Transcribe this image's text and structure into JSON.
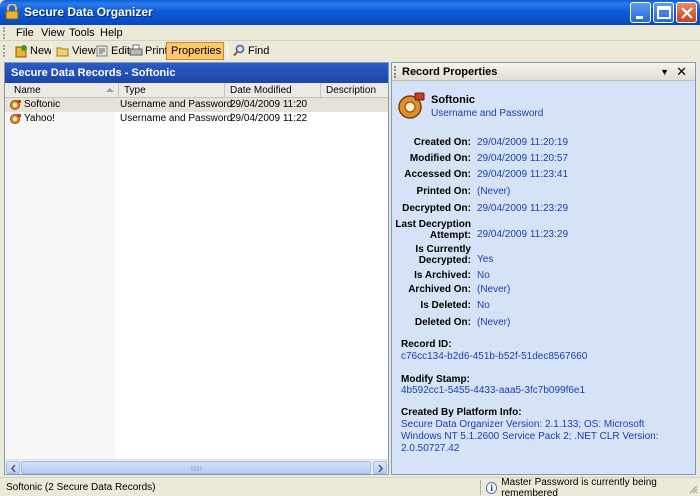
{
  "window": {
    "title": "Secure Data Organizer",
    "icon": "padlock-icon"
  },
  "menu": [
    "File",
    "View",
    "Tools",
    "Help"
  ],
  "toolbar": {
    "buttons": [
      {
        "label": "New",
        "icon": "new-record-icon"
      },
      {
        "label": "View",
        "icon": "folder-open-icon"
      },
      {
        "label": "Edit",
        "icon": "edit-icon"
      },
      {
        "label": "Print",
        "icon": "printer-icon"
      },
      {
        "label": "Properties",
        "icon": "properties-icon",
        "active": true
      },
      {
        "label": "Find",
        "icon": "search-icon"
      }
    ]
  },
  "records": {
    "header": "Secure Data Records - Softonic",
    "columns": [
      "Name",
      "Type",
      "Date Modified",
      "Description"
    ],
    "rows": [
      {
        "name": "Softonic",
        "type": "Username and Password",
        "date": "29/04/2009 11:20",
        "description": "",
        "selected": true
      },
      {
        "name": "Yahoo!",
        "type": "Username and Password",
        "date": "29/04/2009 11:22",
        "description": "",
        "selected": false
      }
    ]
  },
  "properties": {
    "header": "Record Properties",
    "menu_glyph": "▼",
    "close_glyph": "✕",
    "name": "Softonic",
    "type": "Username and Password",
    "fields": [
      {
        "label": "Created On:",
        "value": "29/04/2009 11:20:19"
      },
      {
        "label": "Modified On:",
        "value": "29/04/2009 11:20:57"
      },
      {
        "label": "Accessed On:",
        "value": "29/04/2009 11:23:41"
      },
      {
        "label": "Printed On:",
        "value": "(Never)"
      },
      {
        "label": "Decrypted On:",
        "value": "29/04/2009 11:23:29"
      },
      {
        "label": "Last Decryption Attempt:",
        "value": "29/04/2009 11:23:29"
      },
      {
        "label": "Is Currently Decrypted:",
        "value": "Yes"
      },
      {
        "label": "Is Archived:",
        "value": "No"
      },
      {
        "label": "Archived On:",
        "value": "(Never)"
      },
      {
        "label": "Is Deleted:",
        "value": "No"
      },
      {
        "label": "Deleted On:",
        "value": "(Never)"
      }
    ],
    "record_id_label": "Record ID:",
    "record_id": "c76cc134-b2d6-451b-b52f-51dec8567660",
    "modify_stamp_label": "Modify Stamp:",
    "modify_stamp": "4b592cc1-5455-4433-aaa5-3fc7b099f6e1",
    "platform_label": "Created By Platform Info:",
    "platform_info": "Secure Data Organizer Version: 2.1.133; OS: Microsoft Windows NT 5.1.2600 Service Pack 2; .NET CLR Version: 2.0.50727.42"
  },
  "status": {
    "left": "Softonic (2 Secure Data Records)",
    "right": "Master Password is currently being remembered",
    "info_glyph": "i"
  }
}
